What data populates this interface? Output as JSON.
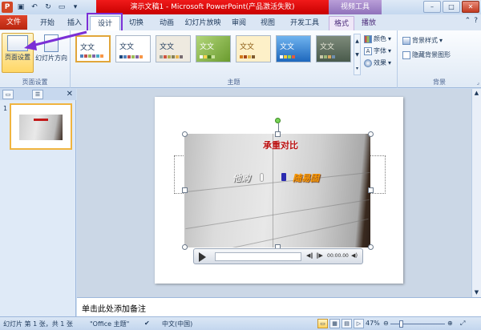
{
  "titlebar": {
    "title": "演示文稿1 - Microsoft PowerPoint(产品激活失败)",
    "context_title": "视频工具",
    "app_icon": "P",
    "qat": [
      "save-icon",
      "undo-icon",
      "redo-icon",
      "slideshow-icon",
      "dropdown-icon"
    ],
    "window_buttons": [
      "–",
      "□",
      "✕"
    ]
  },
  "tabs": [
    {
      "label": "文件",
      "kind": "file"
    },
    {
      "label": "开始"
    },
    {
      "label": "插入"
    },
    {
      "label": "设计",
      "active": true
    },
    {
      "label": "切换"
    },
    {
      "label": "动画"
    },
    {
      "label": "幻灯片放映"
    },
    {
      "label": "审阅"
    },
    {
      "label": "视图"
    },
    {
      "label": "开发工具"
    },
    {
      "label": "格式",
      "context": true
    },
    {
      "label": "播放",
      "context": true
    }
  ],
  "ribbon": {
    "page_setup": {
      "group_label": "页面设置",
      "buttons": [
        "页面设置",
        "幻灯片方向"
      ]
    },
    "themes": {
      "group_label": "主题",
      "thumb_text": "文文",
      "thumb_colors": [
        "#ffffff",
        "#ffffff",
        "#eeeae0",
        "#8fbf4f",
        "#fdf0c8",
        "#2e7fd0",
        "#5c7060"
      ]
    },
    "variants": {
      "colors": "颜色",
      "fonts": "字体",
      "effects": "效果"
    },
    "background": {
      "group_label": "背景",
      "styles": "背景样式",
      "hide_graphics": "隐藏背景图形"
    }
  },
  "thumbnail": {
    "number": "1"
  },
  "video": {
    "caption_top": "承重对比",
    "caption_left": "他购",
    "caption_right": "随易固",
    "time": "00:00.00"
  },
  "notes": {
    "placeholder": "单击此处添加备注"
  },
  "statusbar": {
    "slide_info": "幻灯片 第 1 张，共 1 张",
    "theme": "\"Office 主题\"",
    "language": "中文(中国)",
    "zoom": "47%",
    "zoom_percent": 47
  }
}
